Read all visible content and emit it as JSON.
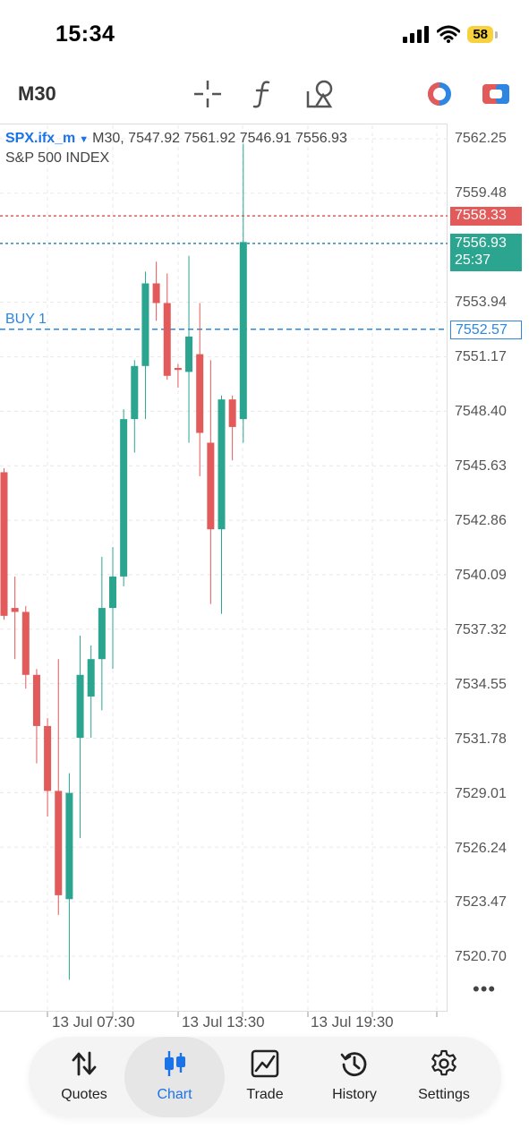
{
  "status_bar": {
    "time": "15:34",
    "battery": "58"
  },
  "toolbar": {
    "timeframe": "M30",
    "icons": [
      "crosshair-icon",
      "function-icon",
      "objects-icon",
      "trading-toggle-icon",
      "account-icon"
    ]
  },
  "chart_info": {
    "symbol": "SPX.ifx_m",
    "ohlc_line": "M30, 7547.92 7561.92 7546.91 7556.93",
    "description": "S&P 500 INDEX"
  },
  "price_axis": [
    "7562.25",
    "7559.48",
    "7553.94",
    "7551.17",
    "7548.40",
    "7545.63",
    "7542.86",
    "7540.09",
    "7537.32",
    "7534.55",
    "7531.78",
    "7529.01",
    "7526.24",
    "7523.47",
    "7520.70"
  ],
  "price_tags": {
    "ask": "7558.33",
    "bid": "7556.93",
    "countdown": "25:37",
    "buy_price": "7552.57",
    "buy_label": "BUY 1"
  },
  "time_axis": [
    "13 Jul 07:30",
    "13 Jul 13:30",
    "13 Jul 19:30"
  ],
  "colors": {
    "bull": "#2ba58f",
    "bear": "#e25a59",
    "accent": "#1a73e8",
    "buy_line": "#2c86e2"
  },
  "chart_data": {
    "type": "candlestick",
    "ylim": [
      7519.4,
      7563.6
    ],
    "candles": [
      {
        "open": 7545.3,
        "high": 7545.5,
        "low": 7537.8,
        "close": 7538.0
      },
      {
        "open": 7538.4,
        "high": 7540.0,
        "low": 7535.8,
        "close": 7538.2
      },
      {
        "open": 7538.2,
        "high": 7538.5,
        "low": 7534.3,
        "close": 7535.0
      },
      {
        "open": 7535.0,
        "high": 7535.3,
        "low": 7530.5,
        "close": 7532.4
      },
      {
        "open": 7532.4,
        "high": 7532.8,
        "low": 7527.8,
        "close": 7529.1
      },
      {
        "open": 7529.1,
        "high": 7535.8,
        "low": 7522.8,
        "close": 7523.8
      },
      {
        "open": 7523.6,
        "high": 7530.0,
        "low": 7519.5,
        "close": 7529.0
      },
      {
        "open": 7531.8,
        "high": 7537.0,
        "low": 7526.7,
        "close": 7535.0
      },
      {
        "open": 7533.9,
        "high": 7536.5,
        "low": 7531.8,
        "close": 7535.8
      },
      {
        "open": 7535.8,
        "high": 7541.0,
        "low": 7533.2,
        "close": 7538.4
      },
      {
        "open": 7538.4,
        "high": 7541.5,
        "low": 7535.3,
        "close": 7540.0
      },
      {
        "open": 7540.0,
        "high": 7548.5,
        "low": 7539.5,
        "close": 7548.0
      },
      {
        "open": 7548.0,
        "high": 7551.0,
        "low": 7546.3,
        "close": 7550.7
      },
      {
        "open": 7550.7,
        "high": 7555.5,
        "low": 7548.0,
        "close": 7554.9
      },
      {
        "open": 7554.9,
        "high": 7556.0,
        "low": 7553.0,
        "close": 7553.9
      },
      {
        "open": 7553.9,
        "high": 7555.4,
        "low": 7550.0,
        "close": 7550.2
      },
      {
        "open": 7550.6,
        "high": 7550.8,
        "low": 7549.6,
        "close": 7550.5
      },
      {
        "open": 7550.4,
        "high": 7556.3,
        "low": 7546.8,
        "close": 7552.2
      },
      {
        "open": 7551.3,
        "high": 7553.9,
        "low": 7545.1,
        "close": 7547.3
      },
      {
        "open": 7546.8,
        "high": 7551.0,
        "low": 7538.6,
        "close": 7542.4
      },
      {
        "open": 7542.4,
        "high": 7549.2,
        "low": 7538.1,
        "close": 7549.0
      },
      {
        "open": 7549.0,
        "high": 7549.2,
        "low": 7545.9,
        "close": 7547.6
      },
      {
        "open": 7548.0,
        "high": 7562.0,
        "low": 7546.8,
        "close": 7557.0
      }
    ]
  }
}
